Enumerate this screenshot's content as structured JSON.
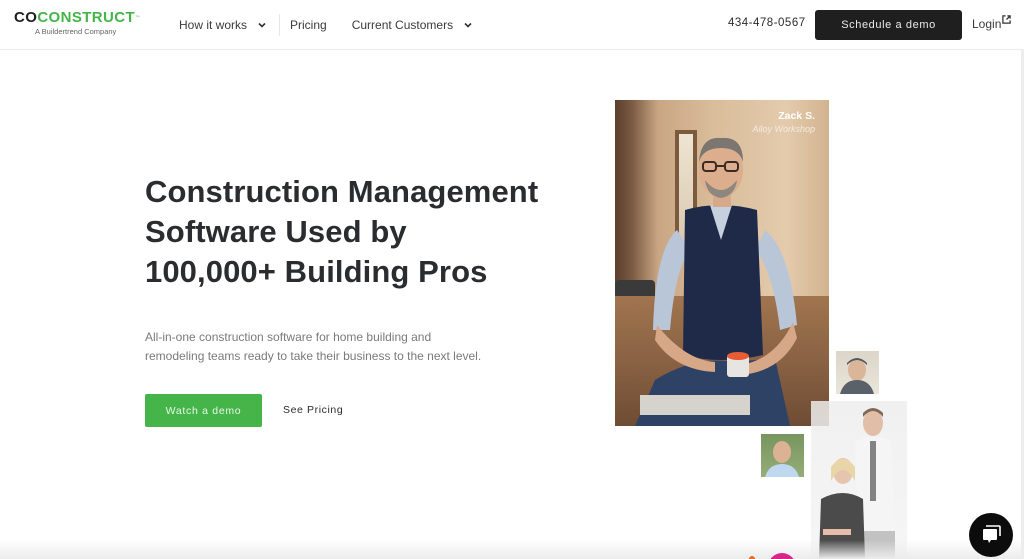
{
  "header": {
    "logo": {
      "part1": "CO",
      "part2": "CONSTRUCT",
      "tm": "™",
      "tagline": "A Buildertrend Company"
    },
    "nav": [
      {
        "label": "How it works",
        "has_dropdown": true
      },
      {
        "label": "Pricing",
        "has_dropdown": false
      },
      {
        "label": "Current Customers",
        "has_dropdown": true
      }
    ],
    "phone": "434-478-0567",
    "schedule_demo_label": "Schedule a demo",
    "login_label": "Login"
  },
  "hero": {
    "title_lines": [
      "Construction Management",
      "Software Used by",
      "100,000+ Building Pros"
    ],
    "subtitle_lines": [
      "All-in-one construction software for home building and",
      "remodeling teams ready to take their business to the next level."
    ],
    "primary_cta": "Watch a demo",
    "secondary_cta": "See Pricing"
  },
  "testimonial": {
    "name": "Zack S.",
    "company": "Alloy Workshop"
  },
  "colors": {
    "brand_green": "#45b54a",
    "dark": "#1f1f1f",
    "text": "#2b2c30",
    "muted": "#7a7a7a"
  },
  "icons": {
    "nav_dropdown": "chevron-down-icon",
    "login": "external-link-icon",
    "chat": "chat-bubble-icon"
  }
}
